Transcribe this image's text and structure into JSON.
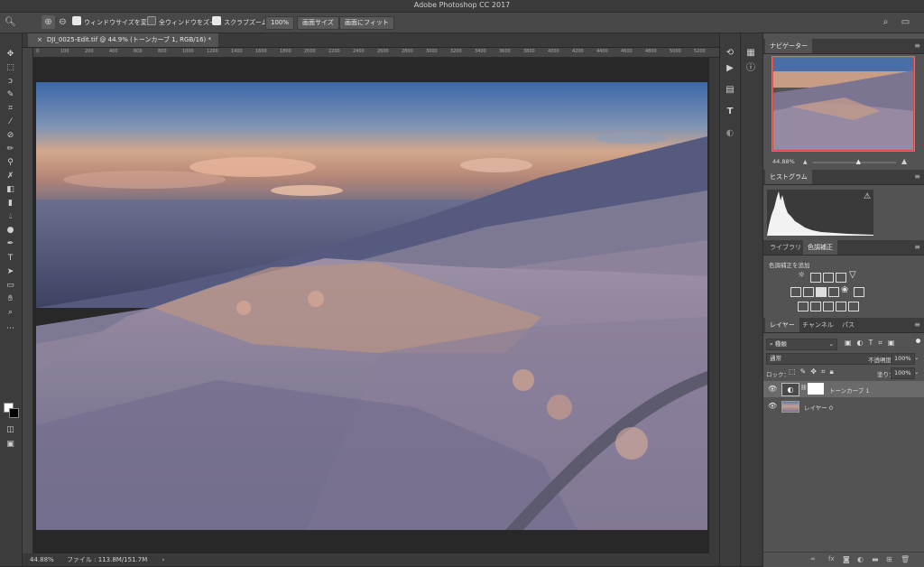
{
  "app": {
    "title": "Adobe Photoshop CC 2017"
  },
  "options": {
    "resize_windows": "ウィンドウサイズを変更",
    "resize_windows_checked": true,
    "zoom_all": "全ウィンドウをズーム",
    "zoom_all_checked": false,
    "scrubby_zoom": "スクラブズーム",
    "scrubby_zoom_checked": true,
    "btn_100": "100%",
    "btn_fill": "画面サイズ",
    "btn_fit": "画面にフィット"
  },
  "document": {
    "tab_label": "DJI_0025-Edit.tif @ 44.9% (トーンカーブ 1, RGB/16) *",
    "ruler_marks": [
      "0",
      "100",
      "200",
      "400",
      "600",
      "800",
      "1000",
      "1200",
      "1400",
      "1600",
      "1800",
      "2000",
      "2200",
      "2400",
      "2600",
      "2800",
      "3000",
      "3200",
      "3400",
      "3600",
      "3800",
      "4000",
      "4200",
      "4400",
      "4600",
      "4800",
      "5000",
      "5200"
    ]
  },
  "status": {
    "zoom": "44.88%",
    "file_info": "ファイル : 113.8M/151.7M"
  },
  "navigator": {
    "tab": "ナビゲーター",
    "zoom": "44.88%",
    "zoom_level": 0.55
  },
  "histogram": {
    "tab": "ヒストグラム"
  },
  "adjustments": {
    "tab_library": "ライブラリ",
    "tab_adjust": "色調補正",
    "add_label": "色調補正を追加"
  },
  "layers": {
    "tab_layers": "レイヤー",
    "tab_channels": "チャンネル",
    "tab_paths": "パス",
    "filter_kind": "種類",
    "blend_mode": "通常",
    "opacity_label": "不透明度：",
    "opacity": "100%",
    "lock_label": "ロック：",
    "fill_label": "塗り：",
    "fill": "100%",
    "items": [
      {
        "name": "トーンカーブ 1",
        "selected": true
      },
      {
        "name": "レイヤー 0",
        "selected": false
      }
    ]
  },
  "colors": {
    "accent_red": "#e0473c",
    "panel_bg": "#535353",
    "selected_row": "#6a6a6a"
  }
}
